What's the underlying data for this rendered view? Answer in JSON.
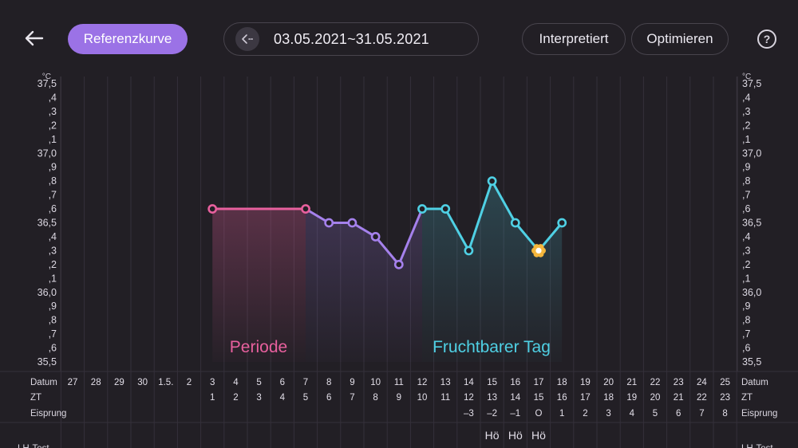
{
  "header": {
    "reference_label": "Referenzkurve",
    "date_range": "03.05.2021~31.05.2021",
    "interpreted_label": "Interpretiert",
    "optimize_label": "Optimieren",
    "help_glyph": "?"
  },
  "icons": {
    "back": "arrow-left-icon",
    "range": "chevron-collapse-icon",
    "help": "question-circle-icon",
    "ovulation": "flower-icon"
  },
  "colors": {
    "accent": "#9b72e6",
    "period": "#e8609e",
    "fertile": "#4fd0e4",
    "purple_line": "#a581ec",
    "ovulation_marker": "#f4b63c"
  },
  "chart_data": {
    "type": "line",
    "unit": "°C",
    "y_ticks": [
      "37,5",
      ",4",
      ",3",
      ",2",
      ",1",
      "37,0",
      ",9",
      ",8",
      ",7",
      ",6",
      "36,5",
      ",4",
      ",3",
      ",2",
      ",1",
      "36,0",
      ",9",
      ",8",
      ",7",
      ",6",
      "35,5"
    ],
    "ylim": [
      35.5,
      37.5
    ],
    "row_labels": {
      "datum": "Datum",
      "zt": "ZT",
      "eisprung": "Eisprung",
      "lh": "LH-Test"
    },
    "dates": [
      "27",
      "28",
      "29",
      "30",
      "1.5.",
      "2",
      "3",
      "4",
      "5",
      "6",
      "7",
      "8",
      "9",
      "10",
      "11",
      "12",
      "13",
      "14",
      "15",
      "16",
      "17",
      "18",
      "19",
      "20",
      "21",
      "22",
      "23",
      "24",
      "25"
    ],
    "cycle_days": [
      "",
      "",
      "",
      "",
      "",
      "",
      "1",
      "2",
      "3",
      "4",
      "5",
      "6",
      "7",
      "8",
      "9",
      "10",
      "11",
      "12",
      "13",
      "14",
      "15",
      "16",
      "17",
      "18",
      "19",
      "20",
      "21",
      "22",
      "23"
    ],
    "ovulation_offsets": [
      "",
      "",
      "",
      "",
      "",
      "",
      "",
      "",
      "",
      "",
      "",
      "",
      "",
      "",
      "",
      "",
      "",
      "–3",
      "–2",
      "–1",
      "O",
      "1",
      "2",
      "3",
      "4",
      "5",
      "6",
      "7",
      "8"
    ],
    "mucus_labels": [
      "",
      "",
      "",
      "",
      "",
      "",
      "",
      "",
      "",
      "",
      "",
      "",
      "",
      "",
      "",
      "",
      "",
      "",
      "Hö",
      "Hö",
      "Hö",
      "",
      "",
      "",
      "",
      "",
      "",
      "",
      ""
    ],
    "temperatures": [
      {
        "date": "3",
        "value": 36.6,
        "phase": "period"
      },
      {
        "date": "7",
        "value": 36.6,
        "phase": "period"
      },
      {
        "date": "8",
        "value": 36.5,
        "phase": "normal"
      },
      {
        "date": "9",
        "value": 36.5,
        "phase": "normal"
      },
      {
        "date": "10",
        "value": 36.4,
        "phase": "normal"
      },
      {
        "date": "11",
        "value": 36.2,
        "phase": "normal"
      },
      {
        "date": "12",
        "value": 36.6,
        "phase": "fertile"
      },
      {
        "date": "13",
        "value": 36.6,
        "phase": "fertile"
      },
      {
        "date": "14",
        "value": 36.3,
        "phase": "fertile"
      },
      {
        "date": "15",
        "value": 36.8,
        "phase": "fertile"
      },
      {
        "date": "16",
        "value": 36.5,
        "phase": "fertile"
      },
      {
        "date": "17",
        "value": 36.3,
        "phase": "ovulation"
      },
      {
        "date": "18",
        "value": 36.5,
        "phase": "fertile"
      }
    ],
    "annotations": {
      "period": "Periode",
      "fertile": "Fruchtbarer Tag"
    }
  }
}
